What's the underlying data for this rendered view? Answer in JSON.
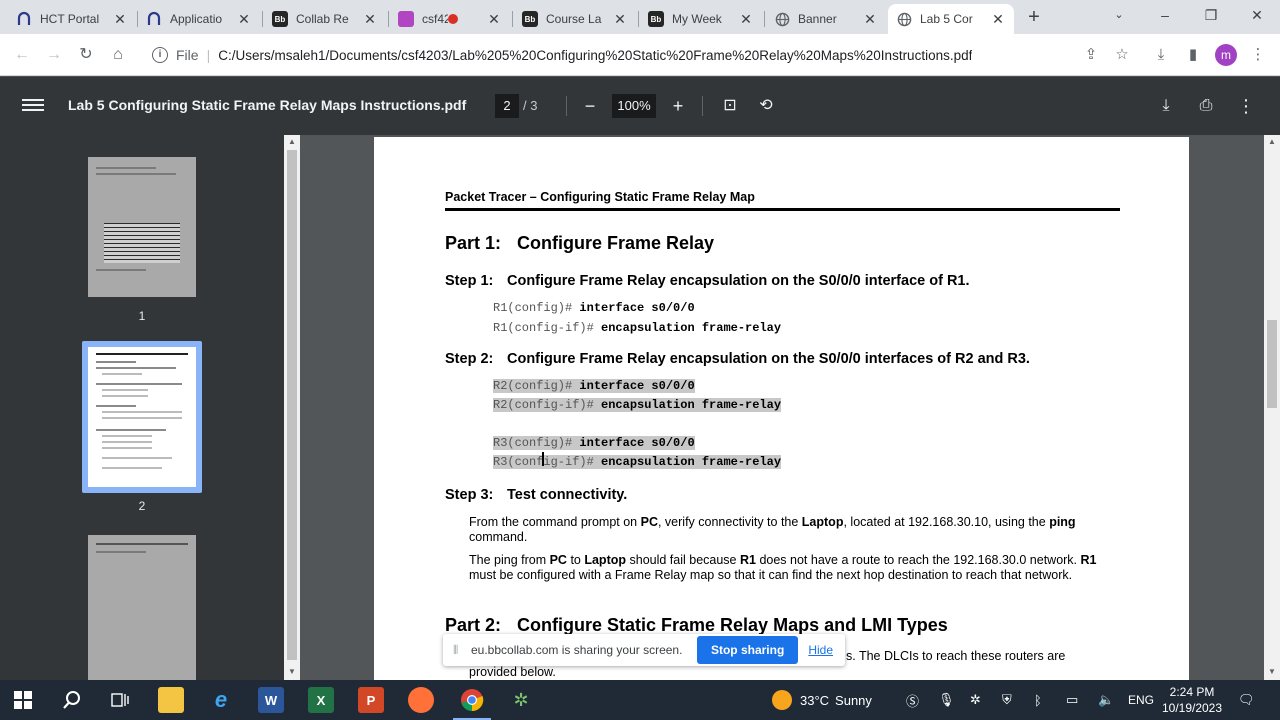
{
  "browser": {
    "tabs": [
      {
        "label": "HCT Portal",
        "icon": "hct-logo-icon",
        "color": "#2b3a8c"
      },
      {
        "label": "Applicatio",
        "icon": "hct-logo-icon",
        "color": "#2b3a8c"
      },
      {
        "label": "Collab Re",
        "icon": "blackboard-icon",
        "color": "#262626"
      },
      {
        "label": "csf42",
        "icon": "app-icon",
        "color": "#b146c2"
      },
      {
        "label": "Course La",
        "icon": "blackboard-icon",
        "color": "#262626"
      },
      {
        "label": "My Week",
        "icon": "blackboard-icon",
        "color": "#262626"
      },
      {
        "label": "Banner",
        "icon": "globe-icon",
        "color": "#5f6368"
      },
      {
        "label": "Lab 5 Cor",
        "icon": "globe-icon",
        "color": "#5f6368"
      }
    ],
    "omnibox": {
      "scheme": "File",
      "url": "C:/Users/msaleh1/Documents/csf4203/Lab%205%20Configuring%20Static%20Frame%20Relay%20Maps%20Instructions.pdf"
    },
    "profile_initial": "m"
  },
  "pdf": {
    "title": "Lab 5 Configuring Static Frame Relay Maps Instructions.pdf",
    "current_page": "2",
    "total_pages": "/ 3",
    "zoom": "100%",
    "thumbnails": [
      "1",
      "2"
    ]
  },
  "doc": {
    "header": "Packet Tracer – Configuring Static Frame Relay Map",
    "part1": {
      "label": "Part 1:",
      "title": "Configure Frame Relay"
    },
    "step1": {
      "label": "Step 1:",
      "title": "Configure Frame Relay encapsulation on the S0/0/0 interface of R1."
    },
    "step1_code": [
      {
        "prompt": "R1(config)#",
        "cmd": "interface s0/0/0"
      },
      {
        "prompt": "R1(config-if)#",
        "cmd": "encapsulation frame-relay"
      }
    ],
    "step2": {
      "label": "Step 2:",
      "title": "Configure Frame Relay encapsulation on the S0/0/0 interfaces of R2 and R3."
    },
    "step2_code": [
      {
        "prompt": "R2(config)#",
        "cmd": "interface s0/0/0"
      },
      {
        "prompt": "R2(config-if)#",
        "cmd": "encapsulation frame-relay"
      },
      {
        "prompt": "R3(config)#",
        "cmd": "interface s0/0/0"
      },
      {
        "prompt": "R3(config-if)#",
        "cmd": "encapsulation frame-relay"
      }
    ],
    "step3": {
      "label": "Step 3:",
      "title": "Test connectivity."
    },
    "para1": {
      "t1": "From the command prompt on ",
      "b1": "PC",
      "t2": ", verify connectivity to the ",
      "b2": "Laptop",
      "t3": ", located at 192.168.30.10, using the ",
      "b3": "ping",
      "t4": " command."
    },
    "para2": {
      "t1": "The ping from ",
      "b1": "PC",
      "t2": " to ",
      "b2": "Laptop",
      "t3": " should fail because ",
      "b3": "R1",
      "t4": " does not have a route to reach the 192.168.30.0 network. ",
      "b4": "R1",
      "t5": " must be configured with a Frame Relay map so that it can find the next hop destination to reach that network."
    },
    "part2": {
      "label": "Part 2:",
      "title": "Configure Static Frame Relay Maps and LMI Types"
    },
    "part2_tail": "s. The DLCIs to reach these routers are",
    "part2_tail2": "provided below."
  },
  "share_banner": {
    "message": "eu.bbcollab.com is sharing your screen.",
    "stop_label": "Stop sharing",
    "hide_label": "Hide"
  },
  "taskbar": {
    "weather_temp": "33°C",
    "weather_desc": "Sunny",
    "lang": "ENG",
    "time": "2:24 PM",
    "date": "10/19/2023"
  }
}
